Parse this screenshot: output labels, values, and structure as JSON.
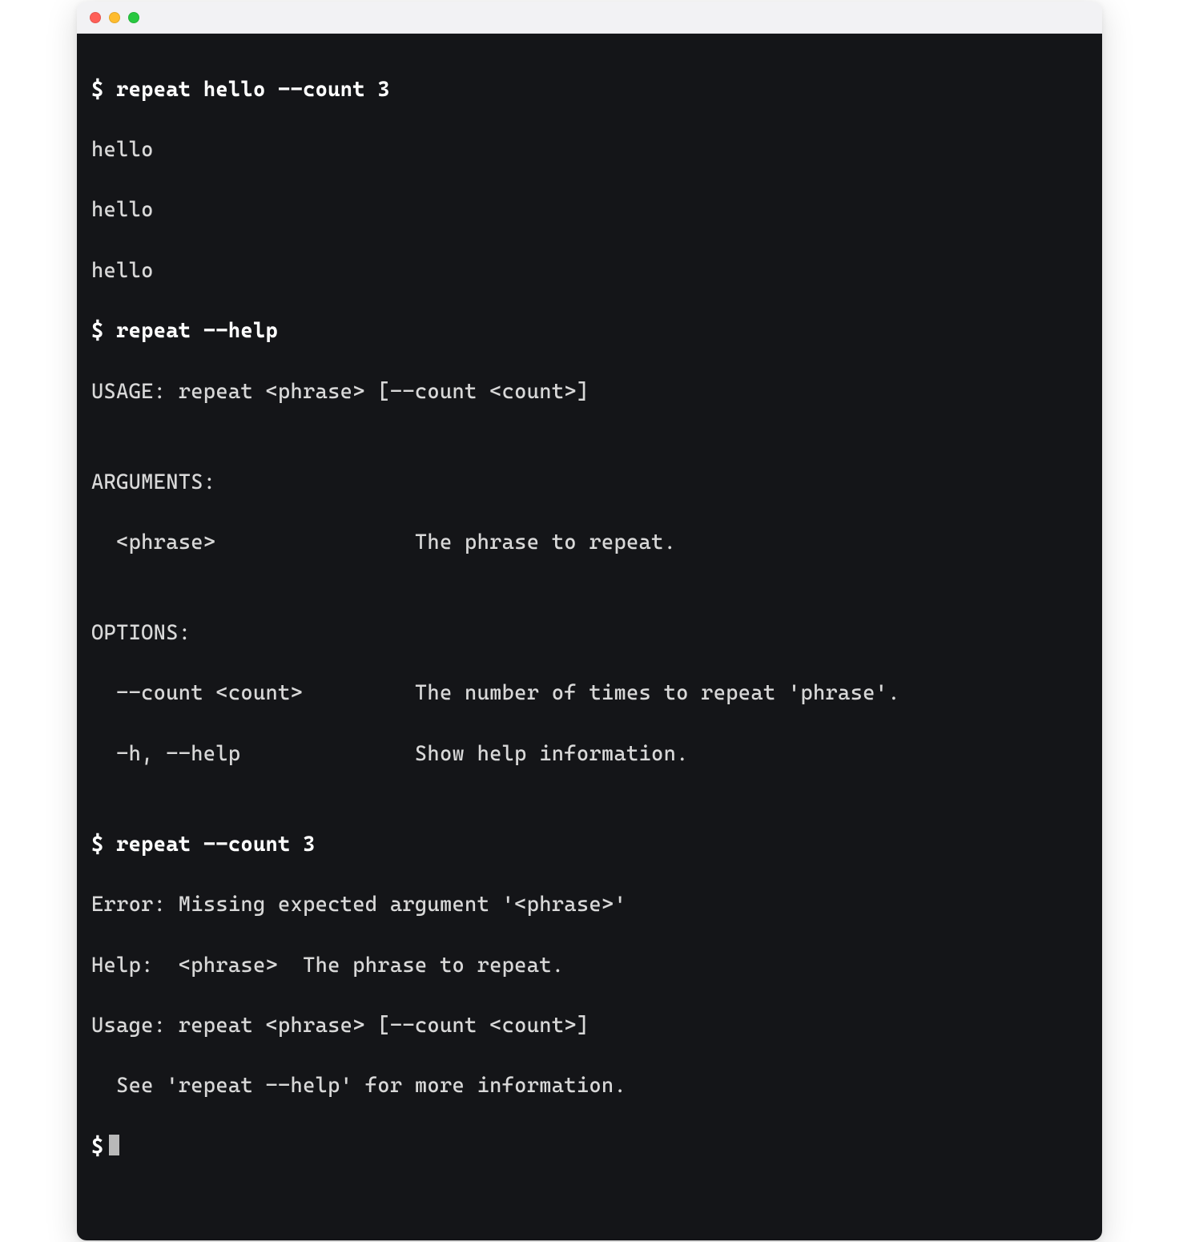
{
  "window": {
    "titlebar": {
      "close_name": "close-icon",
      "min_name": "minimize-icon",
      "max_name": "maximize-icon"
    }
  },
  "terminal": {
    "prompt_symbol": "$",
    "commands": {
      "cmd1": "repeat hello --count 3",
      "cmd1_out_l1": "hello",
      "cmd1_out_l2": "hello",
      "cmd1_out_l3": "hello",
      "cmd2": "repeat --help",
      "help_usage": "USAGE: repeat <phrase> [--count <count>]",
      "help_blank1": "",
      "help_args_header": "ARGUMENTS:",
      "help_arg_phrase": "  <phrase>                The phrase to repeat.",
      "help_blank2": "",
      "help_opts_header": "OPTIONS:",
      "help_opt_count": "  --count <count>         The number of times to repeat 'phrase'.",
      "help_opt_help": "  -h, --help              Show help information.",
      "help_blank3": "",
      "cmd3": "repeat --count 3",
      "err_line": "Error: Missing expected argument '<phrase>'",
      "err_help": "Help:  <phrase>  The phrase to repeat.",
      "err_usage": "Usage: repeat <phrase> [--count <count>]",
      "err_see": "  See 'repeat --help' for more information."
    }
  }
}
